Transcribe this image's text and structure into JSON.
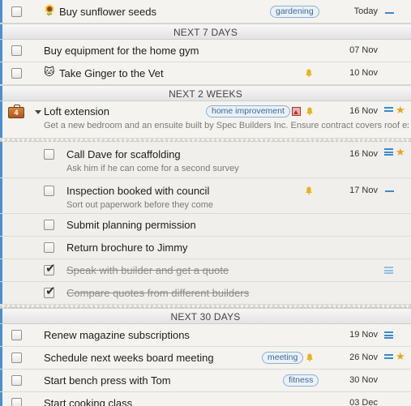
{
  "top_row": {
    "emoji": "🌻",
    "title": "Buy sunflower seeds",
    "tag": "gardening",
    "date": "Today"
  },
  "sections": {
    "next7": "NEXT 7 DAYS",
    "next2w": "NEXT 2 WEEKS",
    "next30": "NEXT 30 DAYS"
  },
  "next7_items": [
    {
      "title": "Buy equipment for the home gym",
      "date": "07 Nov"
    },
    {
      "emoji": "🐱",
      "title": "Take Ginger to the Vet",
      "date": "10 Nov"
    }
  ],
  "project": {
    "badge": "4",
    "title": "Loft extension",
    "tag": "home improvement",
    "date": "16 Nov",
    "note": "Get a new bedroom and an ensuite built by Spec Builders Inc. Ensure contract covers roof ex"
  },
  "subtasks": [
    {
      "title": "Call Dave for scaffolding",
      "note": "Ask him if he can come for a second survey",
      "date": "16 Nov"
    },
    {
      "title": "Inspection booked with council",
      "note": "Sort out paperwork before they come",
      "date": "17 Nov"
    },
    {
      "title": "Submit planning permission"
    },
    {
      "title": "Return brochure to Jimmy"
    },
    {
      "title": "Speak with builder and get a quote"
    },
    {
      "title": "Compare quotes from different builders"
    }
  ],
  "next30_items": [
    {
      "title": "Renew magazine subscriptions",
      "date": "19 Nov"
    },
    {
      "title": "Schedule next weeks board meeting",
      "tag": "meeting",
      "date": "26 Nov"
    },
    {
      "title": "Start bench press with Tom",
      "tag": "fitness",
      "date": "30 Nov"
    },
    {
      "title": "Start cooking class",
      "date": "03 Dec"
    }
  ],
  "colors": {
    "accent": "#4a8fd0",
    "star": "#e9a417",
    "bell": "#e9b21c",
    "tag_border": "#8fb0d0"
  },
  "icons": {
    "star": "★",
    "check": "✔"
  }
}
